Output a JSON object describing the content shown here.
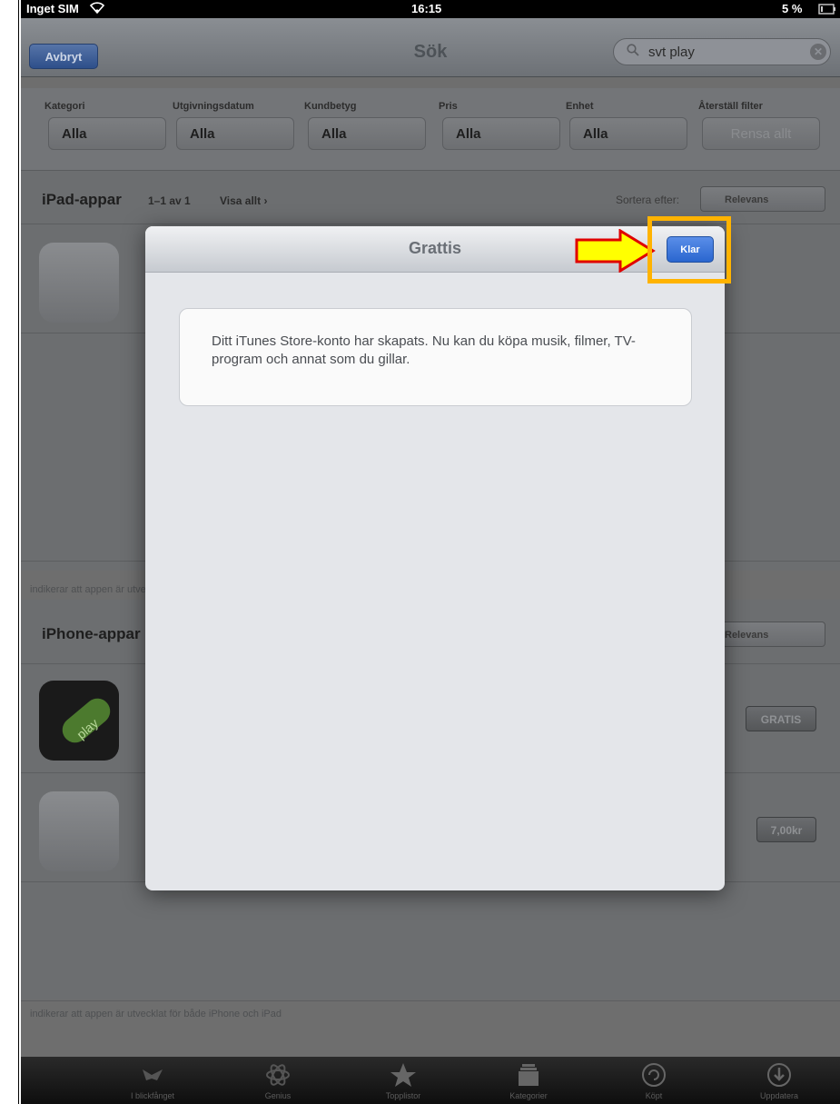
{
  "status_bar": {
    "carrier": "Inget SIM",
    "time": "16:15",
    "battery": "5 %"
  },
  "nav": {
    "cancel_label": "Avbryt",
    "title": "Sök"
  },
  "search": {
    "value": "svt play"
  },
  "filters": [
    {
      "label": "Kategori",
      "value": "Alla"
    },
    {
      "label": "Utgivningsdatum",
      "value": "Alla"
    },
    {
      "label": "Kundbetyg",
      "value": "Alla"
    },
    {
      "label": "Pris",
      "value": "Alla"
    },
    {
      "label": "Enhet",
      "value": "Alla"
    },
    {
      "label": "Återställ filter",
      "value": "Rensa allt"
    }
  ],
  "ipad_section": {
    "title": "iPad-appar",
    "count": "1–1 av 1",
    "see_all": "Visa allt ›",
    "sort_label": "Sortera efter:",
    "sort_value": "Relevans",
    "footnote": "indikerar att appen är utvecklat för både iPhone och iPad"
  },
  "iphone_section": {
    "title": "iPhone-appar",
    "sort_value": "Relevans",
    "price_1": "GRATIS",
    "price_2": "7,00kr",
    "footnote": "indikerar att appen är utvecklat för både iPhone och iPad"
  },
  "tabs": [
    "I blickfånget",
    "Genius",
    "Topplistor",
    "Kategorier",
    "Köpt",
    "Uppdatera"
  ],
  "modal": {
    "title": "Grattis",
    "done_label": "Klar",
    "message": "Ditt iTunes Store-konto har skapats. Nu kan du köpa musik, filmer, TV-program och annat som du gillar."
  },
  "colors": {
    "highlight": "#ffb300",
    "arrow_fill": "#ffff00",
    "arrow_stroke": "#e00000",
    "done_button": "#2a66cf"
  }
}
